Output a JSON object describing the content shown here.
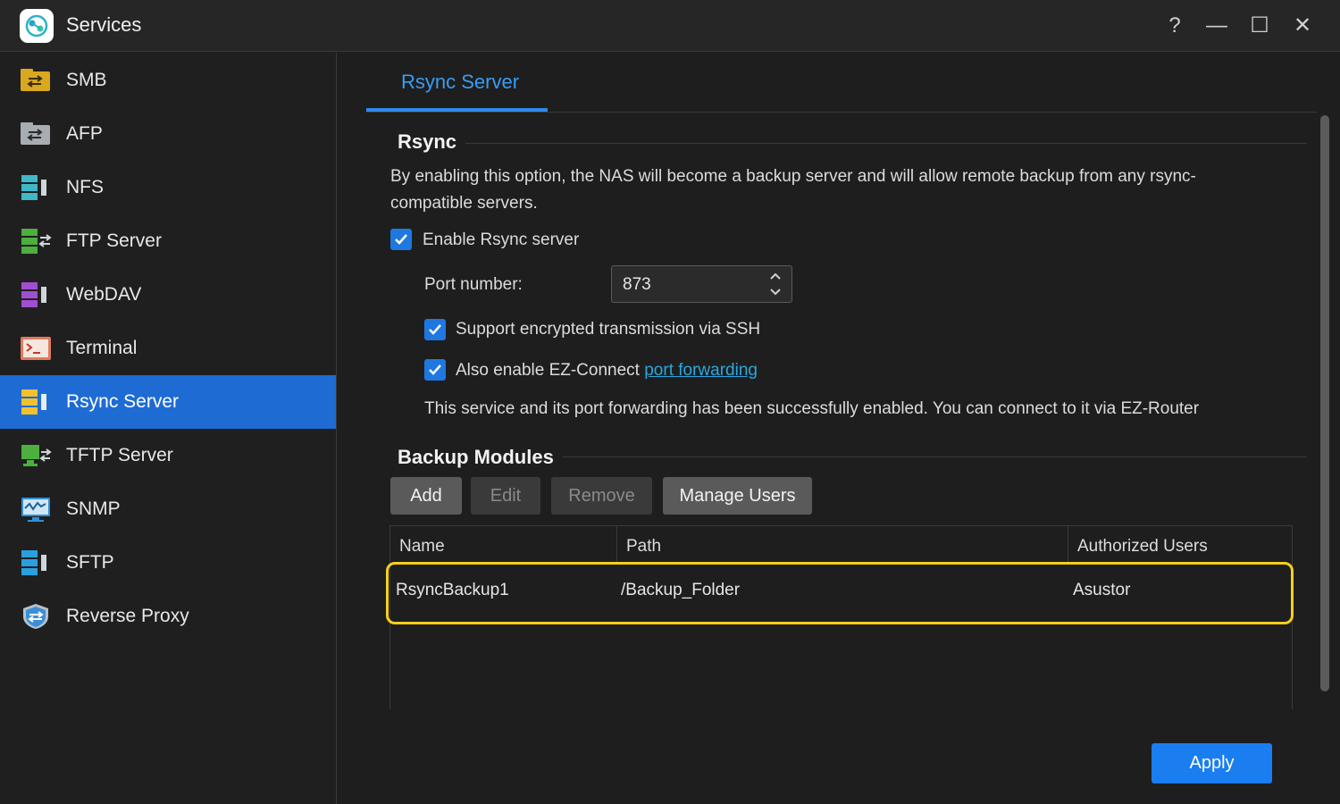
{
  "window": {
    "title": "Services",
    "controls": {
      "help": "?",
      "minimize": "—",
      "maximize": "☐",
      "close": "✕"
    }
  },
  "sidebar": {
    "items": [
      {
        "label": "SMB",
        "icon": "smb-folder-icon"
      },
      {
        "label": "AFP",
        "icon": "afp-folder-icon"
      },
      {
        "label": "NFS",
        "icon": "nfs-server-icon"
      },
      {
        "label": "FTP Server",
        "icon": "ftp-server-icon"
      },
      {
        "label": "WebDAV",
        "icon": "webdav-server-icon"
      },
      {
        "label": "Terminal",
        "icon": "terminal-icon"
      },
      {
        "label": "Rsync Server",
        "icon": "rsync-server-icon"
      },
      {
        "label": "TFTP Server",
        "icon": "tftp-server-icon"
      },
      {
        "label": "SNMP",
        "icon": "snmp-monitor-icon"
      },
      {
        "label": "SFTP",
        "icon": "sftp-server-icon"
      },
      {
        "label": "Reverse Proxy",
        "icon": "reverse-proxy-shield-icon"
      }
    ],
    "active_index": 6
  },
  "tabs": [
    {
      "label": "Rsync Server",
      "active": true
    }
  ],
  "rsync": {
    "section_title": "Rsync",
    "description": "By enabling this option, the NAS will become a backup server and will allow remote backup from any rsync-compatible servers.",
    "enable_label": "Enable Rsync server",
    "enable_checked": true,
    "port_label": "Port number:",
    "port_value": "873",
    "ssh_label": "Support encrypted transmission via SSH",
    "ssh_checked": true,
    "ezconnect_label": "Also enable EZ-Connect ",
    "ezconnect_link": "port forwarding",
    "ezconnect_checked": true,
    "status_text": "This service and its port forwarding has been successfully enabled. You can connect to it via EZ-Router"
  },
  "backup_modules": {
    "section_title": "Backup Modules",
    "buttons": {
      "add": "Add",
      "edit": "Edit",
      "remove": "Remove",
      "manage_users": "Manage Users"
    },
    "columns": [
      "Name",
      "Path",
      "Authorized Users"
    ],
    "rows": [
      {
        "name": "RsyncBackup1",
        "path": "/Backup_Folder",
        "users": "Asustor"
      }
    ]
  },
  "footer": {
    "apply_label": "Apply"
  },
  "colors": {
    "accent": "#1f6bd4",
    "tab_text": "#3b9cf2",
    "highlight": "#f5cf1c",
    "link": "#2aa7e0",
    "apply": "#1a7ef0"
  }
}
